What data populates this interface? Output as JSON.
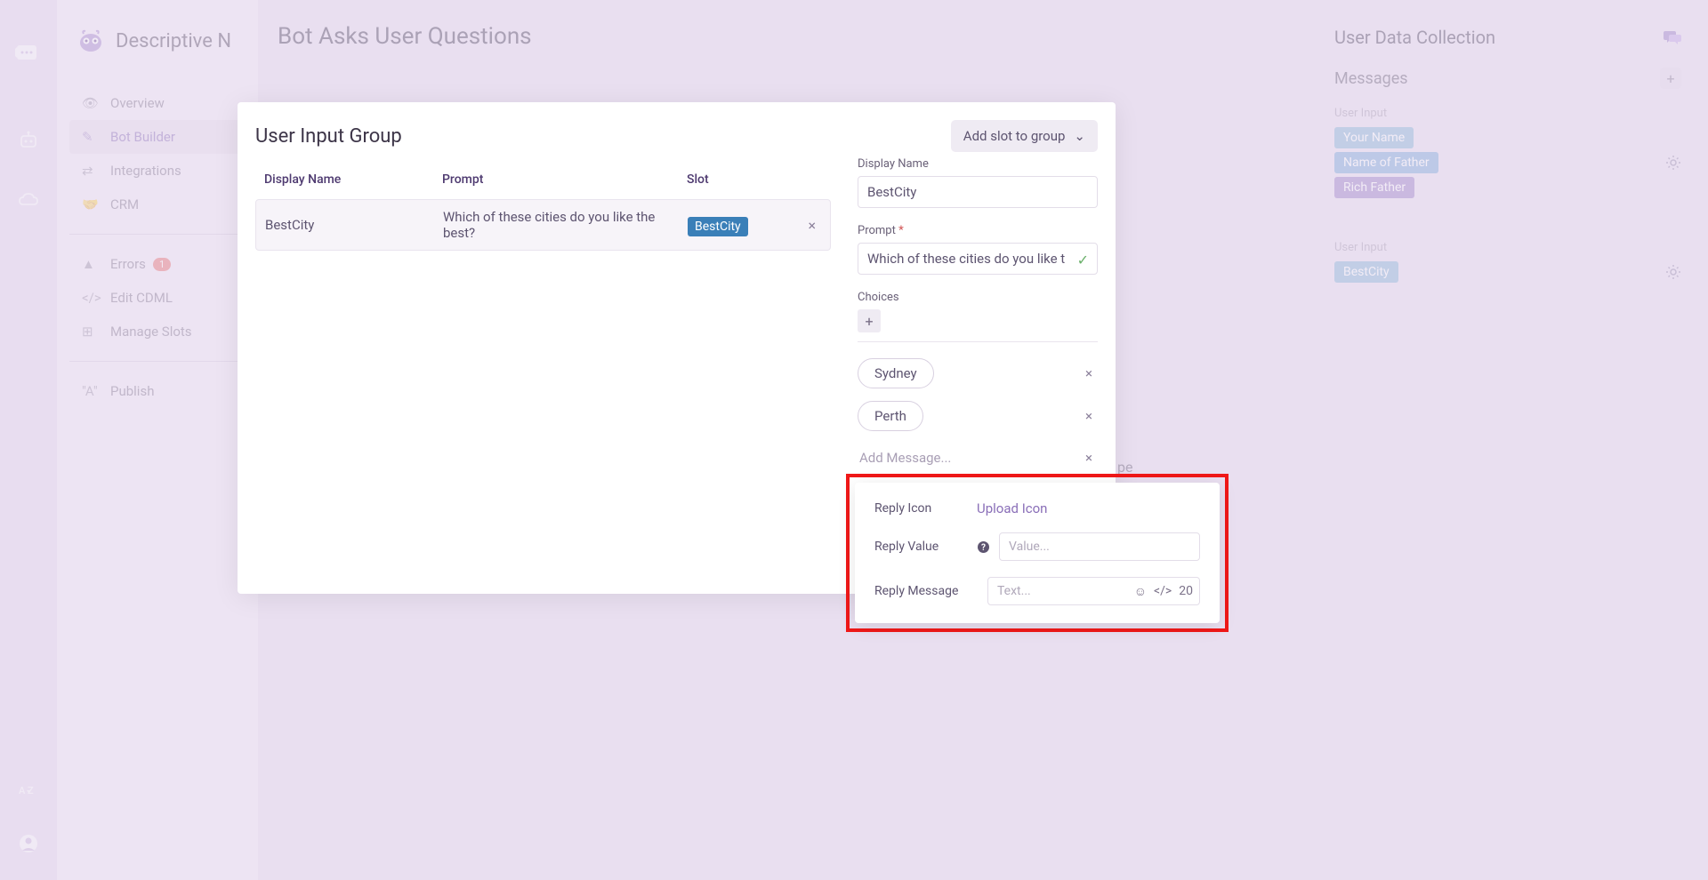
{
  "rail": {
    "icons": [
      "chat-bubble",
      "bot",
      "cloud",
      "az",
      "user"
    ]
  },
  "sidebar": {
    "title": "Descriptive N",
    "items": [
      {
        "label": "Overview"
      },
      {
        "label": "Bot Builder"
      },
      {
        "label": "Integrations"
      },
      {
        "label": "CRM"
      },
      {
        "label": "Errors",
        "badge": "1"
      },
      {
        "label": "Edit CDML"
      },
      {
        "label": "Manage Slots"
      },
      {
        "label": "Publish"
      }
    ]
  },
  "main": {
    "title": "Bot Asks User Questions"
  },
  "rightPanel": {
    "title": "User Data Collection",
    "messagesLabel": "Messages",
    "userInputLabel1": "User Input",
    "tags1": [
      "Your Name",
      "Name of Father",
      "Rich Father"
    ],
    "userInputLabel2": "User Input",
    "tags2": [
      "BestCity"
    ]
  },
  "modal": {
    "title": "User Input Group",
    "addSlot": "Add slot to group",
    "columns": {
      "displayName": "Display Name",
      "prompt": "Prompt",
      "slot": "Slot"
    },
    "row": {
      "displayName": "BestCity",
      "prompt": "Which of these cities do you like the best?",
      "slot": "BestCity"
    },
    "form": {
      "displayNameLabel": "Display Name",
      "displayNameValue": "BestCity",
      "promptLabel": "Prompt",
      "promptValue": "Which of these cities do you like t",
      "choicesLabel": "Choices",
      "choices": [
        "Sydney",
        "Perth"
      ],
      "addMessage": "Add Message..."
    }
  },
  "replyPopover": {
    "replyIconLabel": "Reply Icon",
    "uploadIcon": "Upload Icon",
    "replyValueLabel": "Reply Value",
    "valuePlaceholder": "Value...",
    "replyMessageLabel": "Reply Message",
    "textPlaceholder": "Text...",
    "charCount": "20"
  },
  "peText": "pe"
}
